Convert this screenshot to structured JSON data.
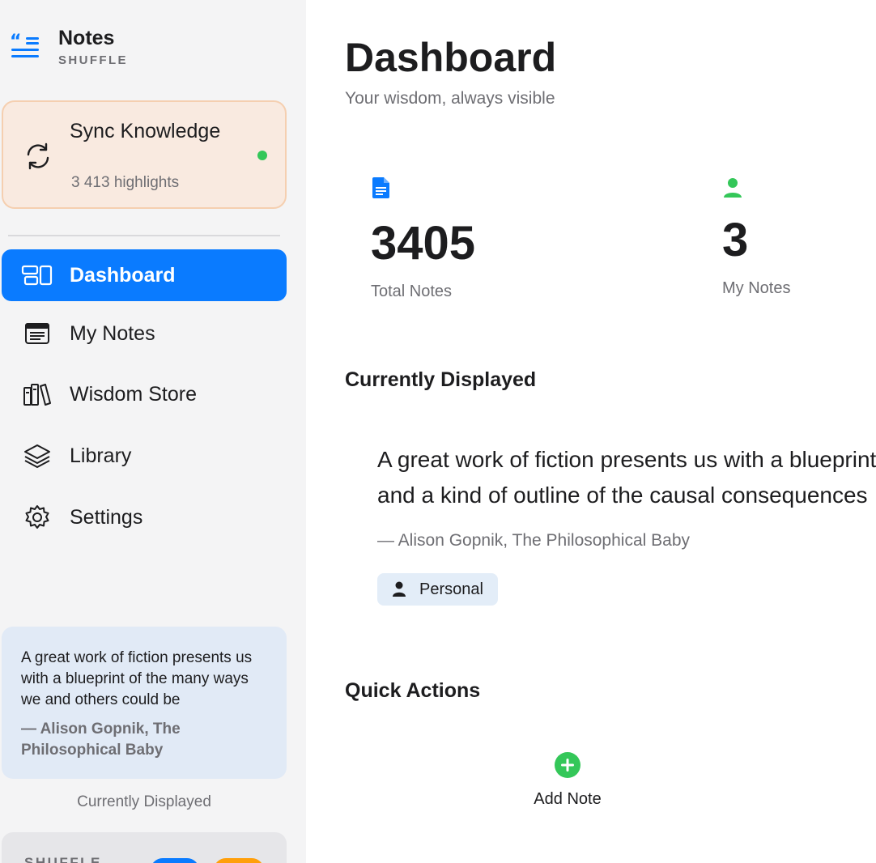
{
  "brand": {
    "title": "Notes",
    "subtitle": "SHUFFLE",
    "icon": "quote-list-icon"
  },
  "sync": {
    "title": "Sync Knowledge",
    "count": "3 413 highlights",
    "icon": "sync-icon",
    "status_color": "#34c759"
  },
  "nav": [
    {
      "label": "Dashboard",
      "icon": "dashboard-icon",
      "active": true
    },
    {
      "label": "My Notes",
      "icon": "notes-icon",
      "active": false
    },
    {
      "label": "Wisdom Store",
      "icon": "books-icon",
      "active": false
    },
    {
      "label": "Library",
      "icon": "layers-icon",
      "active": false
    },
    {
      "label": "Settings",
      "icon": "gear-icon",
      "active": false
    }
  ],
  "sidebar_quote": {
    "text": "A great work of fiction presents us with a blueprint of the many ways we and others could be",
    "author": "— Alison Gopnik, The Philosophical Baby",
    "caption": "Currently Displayed"
  },
  "sidebar_bottom": {
    "label": "SHUFFLE"
  },
  "header": {
    "title": "Dashboard",
    "subtitle": "Your wisdom, always visible"
  },
  "stats": [
    {
      "value": "3405",
      "label": "Total Notes",
      "icon": "document-icon",
      "color": "#0a7bff"
    },
    {
      "value": "3",
      "label": "My Notes",
      "icon": "person-icon",
      "color": "#34c759"
    }
  ],
  "current": {
    "heading": "Currently Displayed",
    "line1": "A great work of fiction presents us with a blueprint",
    "line2": "and a kind of outline of the causal consequences",
    "author": "— Alison Gopnik, The Philosophical Baby",
    "tag": "Personal"
  },
  "quick_actions": {
    "heading": "Quick Actions",
    "items": [
      {
        "label": "Add Note",
        "icon": "plus-circle-icon",
        "color": "#34c759"
      }
    ]
  },
  "colors": {
    "accent": "#0a7bff",
    "success": "#34c759",
    "warning": "#ff9f0a"
  }
}
